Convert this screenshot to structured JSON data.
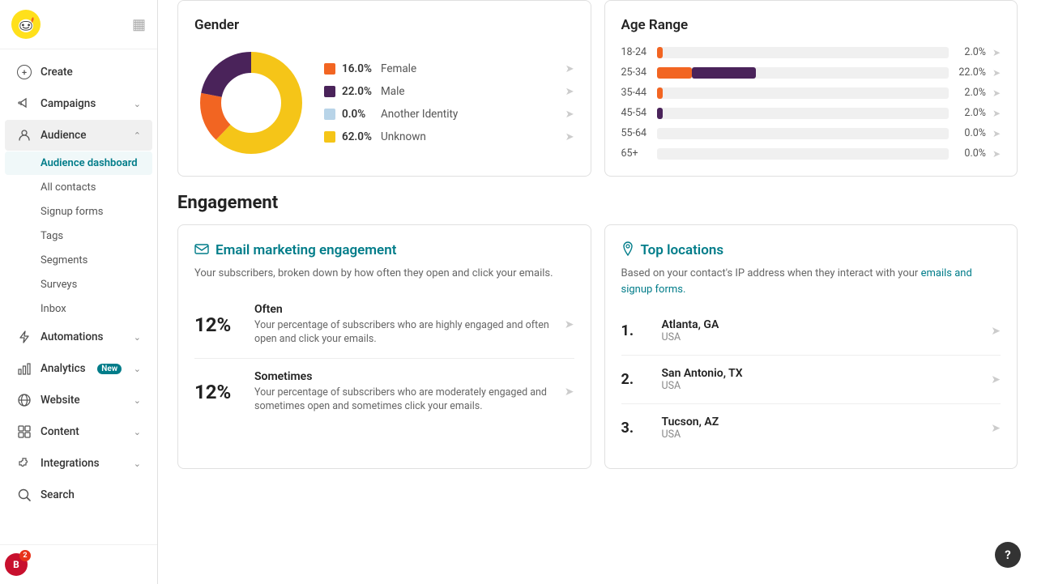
{
  "sidebar": {
    "items": [
      {
        "id": "create",
        "label": "Create",
        "icon": "pencil-icon",
        "hasChevron": false
      },
      {
        "id": "campaigns",
        "label": "Campaigns",
        "icon": "megaphone-icon",
        "hasChevron": true
      },
      {
        "id": "audience",
        "label": "Audience",
        "icon": "people-icon",
        "hasChevron": true,
        "expanded": true
      },
      {
        "id": "automations",
        "label": "Automations",
        "icon": "lightning-icon",
        "hasChevron": true
      },
      {
        "id": "analytics",
        "label": "Analytics",
        "icon": "chart-icon",
        "hasChevron": true,
        "badge": "New"
      },
      {
        "id": "website",
        "label": "Website",
        "icon": "globe-icon",
        "hasChevron": true
      },
      {
        "id": "content",
        "label": "Content",
        "icon": "grid-icon",
        "hasChevron": true
      },
      {
        "id": "integrations",
        "label": "Integrations",
        "icon": "puzzle-icon",
        "hasChevron": true
      },
      {
        "id": "search",
        "label": "Search",
        "icon": "search-icon",
        "hasChevron": false
      }
    ],
    "audience_subitems": [
      {
        "id": "audience-dashboard",
        "label": "Audience dashboard",
        "active": true
      },
      {
        "id": "all-contacts",
        "label": "All contacts",
        "active": false
      },
      {
        "id": "signup-forms",
        "label": "Signup forms",
        "active": false
      },
      {
        "id": "tags",
        "label": "Tags",
        "active": false
      },
      {
        "id": "segments",
        "label": "Segments",
        "active": false
      },
      {
        "id": "surveys",
        "label": "Surveys",
        "active": false
      },
      {
        "id": "inbox",
        "label": "Inbox",
        "active": false
      }
    ],
    "notification_count": "2",
    "avatar_initials": "B"
  },
  "gender": {
    "title": "Gender",
    "segments": [
      {
        "id": "female",
        "color": "#f26522",
        "pct": "16.0%",
        "label": "Female"
      },
      {
        "id": "male",
        "color": "#4a235a",
        "pct": "22.0%",
        "label": "Male"
      },
      {
        "id": "another",
        "color": "#b8d4e8",
        "pct": "0.0%",
        "label": "Another Identity"
      },
      {
        "id": "unknown",
        "color": "#f5c518",
        "pct": "62.0%",
        "label": "Unknown"
      }
    ]
  },
  "age_range": {
    "title": "Age Range",
    "rows": [
      {
        "range": "18-24",
        "pct": "2.0%",
        "orange_width": "2",
        "purple_width": "0"
      },
      {
        "range": "25-34",
        "pct": "22.0%",
        "orange_width": "12",
        "purple_width": "10"
      },
      {
        "range": "35-44",
        "pct": "2.0%",
        "orange_width": "2",
        "purple_width": "0"
      },
      {
        "range": "45-54",
        "pct": "2.0%",
        "orange_width": "2",
        "purple_width": "0"
      },
      {
        "range": "55-64",
        "pct": "0.0%",
        "orange_width": "0",
        "purple_width": "0"
      },
      {
        "range": "65+",
        "pct": "0.0%",
        "orange_width": "0",
        "purple_width": "0"
      }
    ]
  },
  "engagement": {
    "section_title": "Engagement",
    "email_card": {
      "title": "Email marketing engagement",
      "description": "Your subscribers, broken down by how often they open and click your emails.",
      "items": [
        {
          "pct": "12%",
          "label": "Often",
          "description": "Your percentage of subscribers who are highly engaged and often open and click your emails."
        },
        {
          "pct": "12%",
          "label": "Sometimes",
          "description": "Your percentage of subscribers who are moderately engaged and sometimes open and sometimes click your emails."
        }
      ]
    },
    "locations_card": {
      "title": "Top locations",
      "description": "Based on your contact's IP address when they interact with your",
      "description_link": "emails and signup forms.",
      "locations": [
        {
          "rank": "1.",
          "city": "Atlanta, GA",
          "country": "USA"
        },
        {
          "rank": "2.",
          "city": "San Antonio, TX",
          "country": "USA"
        },
        {
          "rank": "3.",
          "city": "Tucson, AZ",
          "country": "USA"
        }
      ]
    }
  },
  "icons": {
    "send": "&#10148;",
    "chevron_down": "&#8964;",
    "chevron_up": "&#8963;"
  }
}
